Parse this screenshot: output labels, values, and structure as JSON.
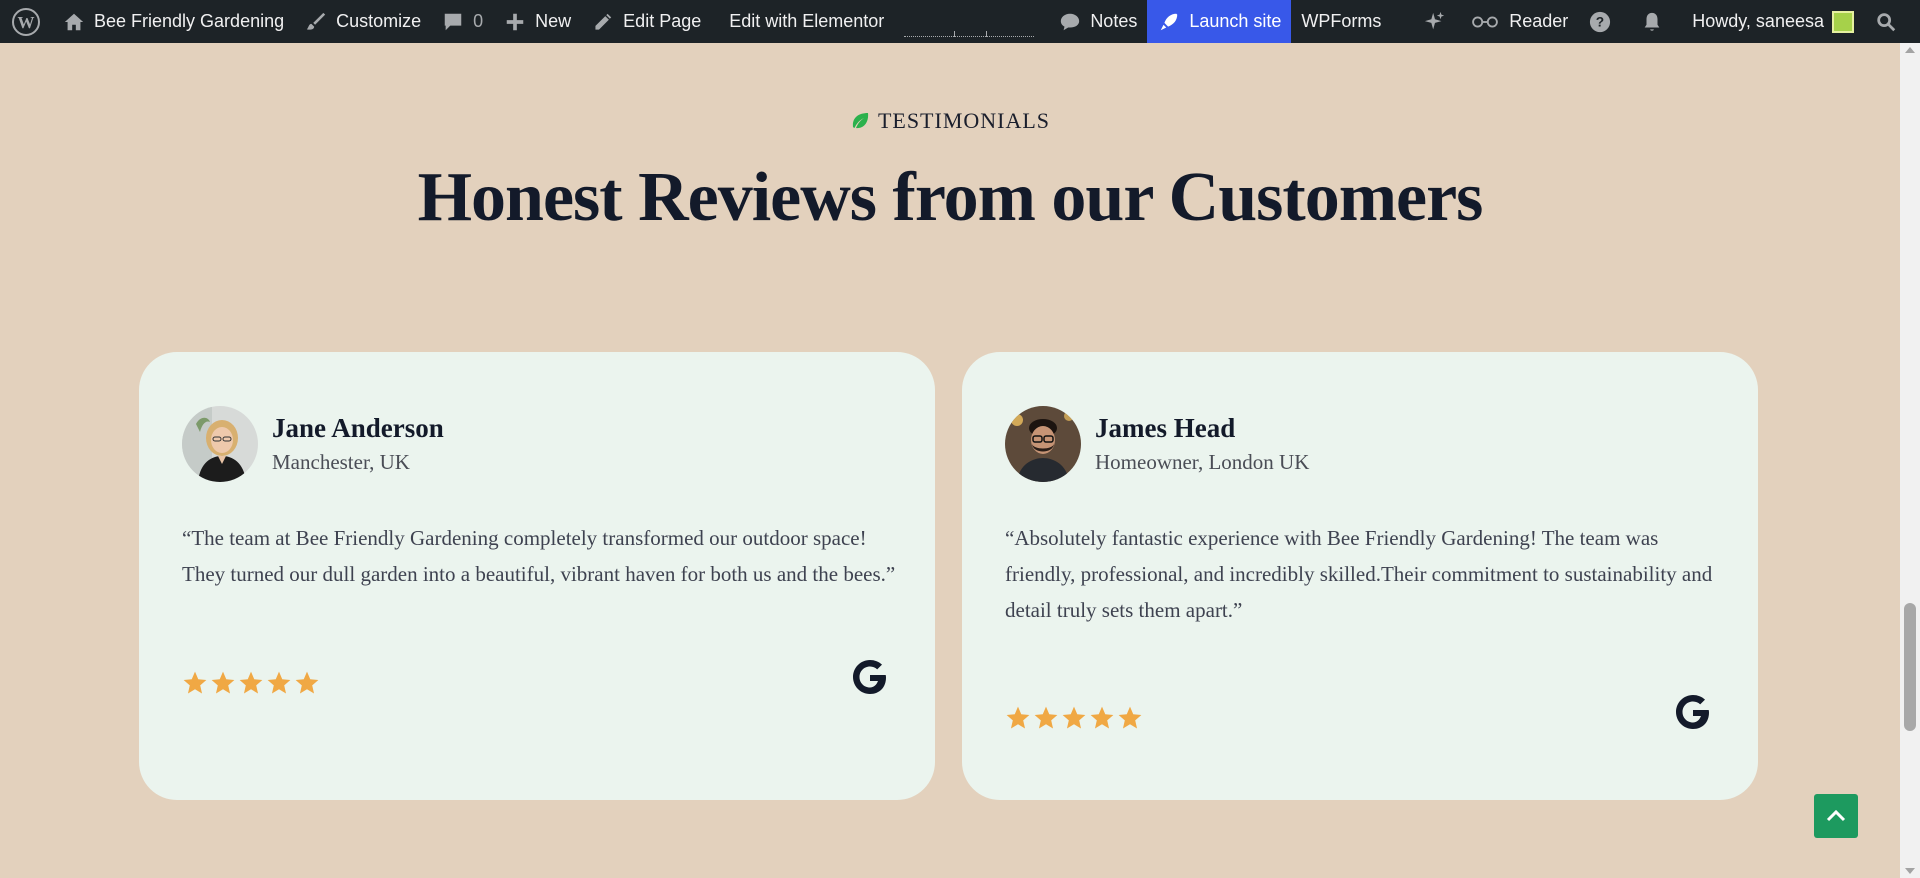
{
  "adminbar": {
    "site_name": "Bee Friendly Gardening",
    "customize": "Customize",
    "comments_count": "0",
    "new": "New",
    "edit_page": "Edit Page",
    "edit_elementor": "Edit with Elementor",
    "notes": "Notes",
    "launch_site": "Launch site",
    "wpforms": "WPForms",
    "reader": "Reader",
    "howdy": "Howdy, saneesa"
  },
  "section": {
    "eyebrow": "TESTIMONIALS",
    "title": "Honest Reviews from our Customers"
  },
  "reviews": [
    {
      "name": "Jane Anderson",
      "role": "Manchester, UK",
      "quote": "“The team at Bee Friendly Gardening completely transformed our outdoor space! They turned our dull garden into a beautiful, vibrant haven for both us and the bees.”",
      "rating": 5,
      "source_icon": "google-icon"
    },
    {
      "name": "James Head",
      "role": "Homeowner, London UK",
      "quote": "“Absolutely fantastic experience with Bee Friendly Gardening! The team was friendly, professional, and incredibly skilled.Their commitment to sustainability and detail truly sets them apart.”",
      "rating": 5,
      "source_icon": "google-icon"
    }
  ],
  "colors": {
    "page_bg": "#e3d1bd",
    "card_bg": "#ebf4ee",
    "star": "#f0a844",
    "accent_green": "#1d9a5f",
    "launch_bg": "#3858e9"
  }
}
